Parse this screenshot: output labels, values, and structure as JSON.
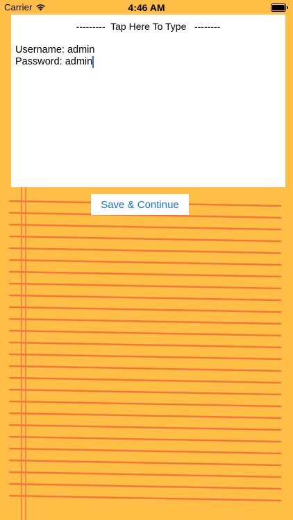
{
  "status_bar": {
    "carrier": "Carrier",
    "time": "4:46 AM",
    "wifi_icon": "wifi-icon",
    "battery_icon": "battery-icon"
  },
  "note_card": {
    "hint": "---------  Tap Here To Type   --------",
    "lines": [
      "Username: admin",
      "Password: admin"
    ]
  },
  "save_button": {
    "label": "Save & Continue"
  },
  "colors": {
    "background": "#FFBF47",
    "ruled_line": "#F5763A",
    "margin_line": "#F5763A",
    "card": "#FFFFFF",
    "button_text": "#1A75E0",
    "cursor": "#2F6BE0"
  }
}
